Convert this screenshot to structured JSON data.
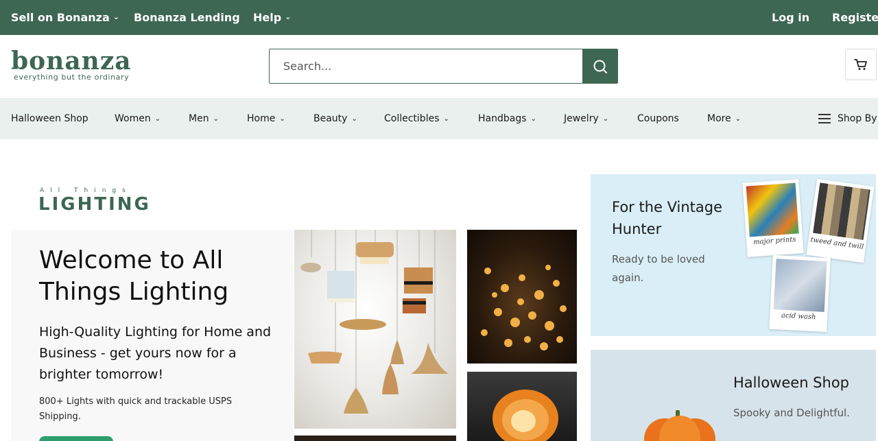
{
  "topbar": {
    "sell_label": "Sell on Bonanza",
    "lending_label": "Bonanza Lending",
    "help_label": "Help",
    "login_label": "Log in",
    "register_label": "Register"
  },
  "header": {
    "logo_text": "bonanza",
    "logo_tagline": "everything but the ordinary",
    "search_placeholder": "Search..."
  },
  "categories": [
    {
      "label": "Halloween Shop",
      "has_menu": false
    },
    {
      "label": "Women",
      "has_menu": true
    },
    {
      "label": "Men",
      "has_menu": true
    },
    {
      "label": "Home",
      "has_menu": true
    },
    {
      "label": "Beauty",
      "has_menu": true
    },
    {
      "label": "Collectibles",
      "has_menu": true
    },
    {
      "label": "Handbags",
      "has_menu": true
    },
    {
      "label": "Jewelry",
      "has_menu": true
    },
    {
      "label": "Coupons",
      "has_menu": false
    },
    {
      "label": "More",
      "has_menu": true
    }
  ],
  "shop_by_label": "Shop By",
  "hero": {
    "brand_small": "All Things",
    "brand_big": "LIGHTING",
    "title": "Welcome to All Things Lighting",
    "subtitle": "High-Quality Lighting for Home and Business - get yours now for a brighter tomorrow!",
    "note": "800+ Lights with quick and trackable USPS Shipping."
  },
  "promos": [
    {
      "title": "For the Vintage Hunter",
      "subtitle": "Ready to be loved again.",
      "photo_captions": [
        "major prints",
        "tweed and twill",
        "acid wash"
      ]
    },
    {
      "title": "Halloween Shop",
      "subtitle": "Spooky and Delightful."
    }
  ],
  "colors": {
    "brand_green": "#3d6653",
    "nav_bg": "#eaf0ee",
    "promo_blue": "#d9eef7"
  }
}
